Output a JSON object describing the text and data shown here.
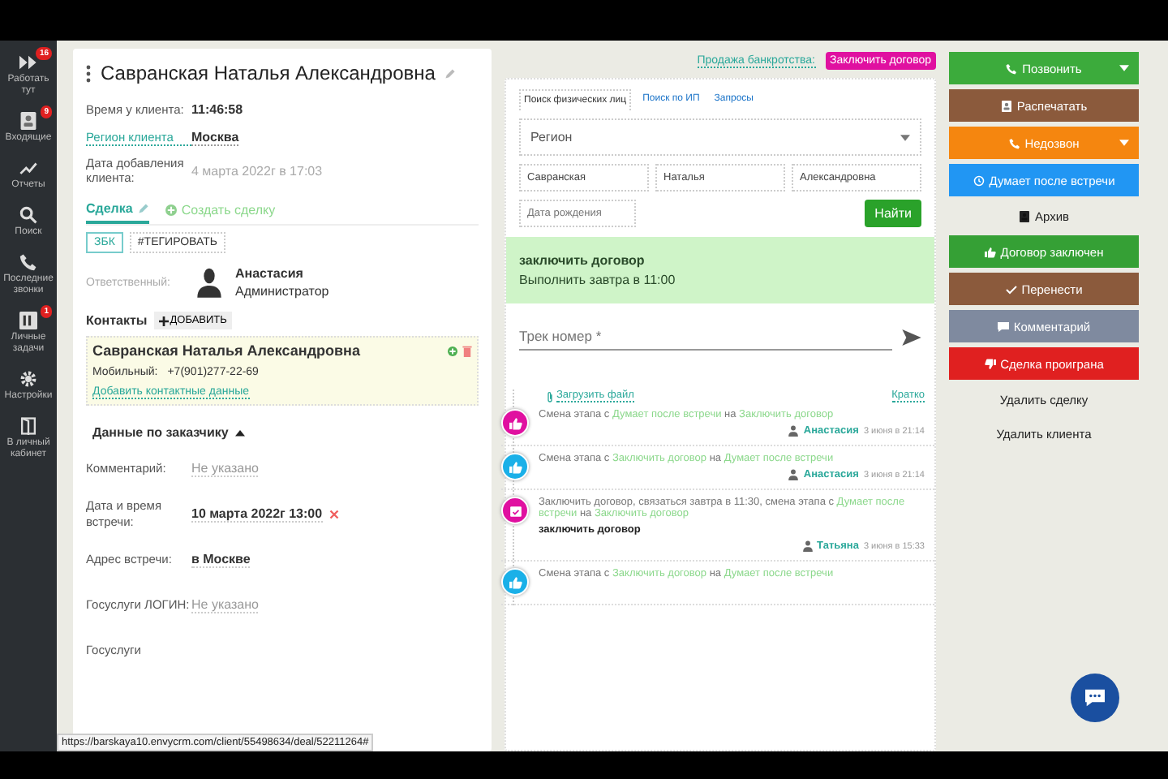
{
  "sidebar": {
    "items": [
      {
        "label": "Работать тут",
        "kind": "forward",
        "badge": "16"
      },
      {
        "label": "Входящие",
        "kind": "contact",
        "badge": "9"
      },
      {
        "label": "Отчеты",
        "kind": "chart"
      },
      {
        "label": "Поиск",
        "kind": "search"
      },
      {
        "label": "Последние звонки",
        "kind": "phone"
      },
      {
        "label": "Личные задачи",
        "kind": "tasks",
        "badge": "1"
      },
      {
        "label": "Настройки",
        "kind": "gear"
      },
      {
        "label": "В личный кабинет",
        "kind": "door"
      }
    ]
  },
  "client": {
    "title": "Савранская Наталья Александровна",
    "fields": [
      {
        "label": "Время у клиента:",
        "value": "11:46:58",
        "kind": "bold"
      },
      {
        "label": "Регион клиента",
        "value": "Москва",
        "kind": "link"
      },
      {
        "label": "Дата добавления клиента:",
        "value": "4 марта 2022г в 17:03",
        "kind": "muted"
      }
    ],
    "tabs": [
      {
        "label": "Сделка",
        "selected": true
      },
      {
        "label": "Создать сделку",
        "selected": false
      }
    ],
    "tags": [
      {
        "label": "ЗБК",
        "kind": "outlined"
      },
      {
        "label": "#ТЕГИРОВАТЬ",
        "kind": "plain"
      }
    ],
    "responsible": {
      "label": "Ответственный:",
      "name": "Анастасия",
      "role": "Администратор"
    },
    "contacts": {
      "title": "Контакты",
      "add": "ДОБАВИТЬ",
      "name": "Савранская Наталья Александровна",
      "phone_label": "Мобильный:",
      "phone": "+7(901)277-22-69",
      "add_link": "Добавить контактные данные"
    },
    "customer": {
      "title": "Данные по заказчику",
      "expanded": true,
      "fields": [
        {
          "label": "Комментарий:",
          "value": "Не указано",
          "kind": "empty"
        },
        {
          "label": "Дата и время встречи:",
          "value": "10 марта 2022г 13:00",
          "kind": "date"
        },
        {
          "label": "Адрес встречи:",
          "value": "в Москве",
          "kind": "set"
        },
        {
          "label": "Госуслуги ЛОГИН:",
          "value": "Не указано",
          "kind": "empty"
        },
        {
          "label": "Госуслуги",
          "kind": "cut"
        }
      ]
    }
  },
  "deal": {
    "pipeline": "Продажа банкротства:",
    "stage": "Заключить договор",
    "search_tabs": [
      {
        "label": "Поиск физических лиц",
        "selected": true
      },
      {
        "label": "Поиск по ИП",
        "selected": false
      },
      {
        "label": "Запросы",
        "selected": false
      }
    ],
    "region": {
      "placeholder": "Регион"
    },
    "inputs": [
      {
        "value": "Савранская"
      },
      {
        "value": "Наталья"
      },
      {
        "value": "Александровна"
      }
    ],
    "birth": {
      "placeholder": "Дата рождения"
    },
    "find": "Найти",
    "task": {
      "title": "заключить договор",
      "due": "Выполнить завтра в 11:00"
    },
    "track": {
      "placeholder": "Трек номер *"
    },
    "upload": "Загрузить файл",
    "brief": "Кратко",
    "timeline": [
      {
        "kind": "thumb",
        "color": "#e010a0",
        "parts": [
          {
            "text": "Смена этапа с ",
            "kind": "plain"
          },
          {
            "text": "Думает после встречи",
            "kind": "link"
          },
          {
            "text": " на ",
            "kind": "plain"
          },
          {
            "text": "Заключить договор",
            "kind": "link"
          }
        ],
        "author": "Анастасия",
        "date": "3 июня в 21:14"
      },
      {
        "kind": "thumb",
        "color": "#1ab0e8",
        "parts": [
          {
            "text": "Смена этапа с ",
            "kind": "plain"
          },
          {
            "text": "Заключить договор",
            "kind": "link"
          },
          {
            "text": " на ",
            "kind": "plain"
          },
          {
            "text": "Думает после встречи",
            "kind": "link"
          }
        ],
        "author": "Анастасия",
        "date": "3 июня в 21:14"
      },
      {
        "kind": "calendar",
        "color": "#e010a0",
        "parts": [
          {
            "text": "Заключить договор, связаться завтра в 11:30, смена этапа с ",
            "kind": "plain"
          },
          {
            "text": "Думает после встречи",
            "kind": "link"
          },
          {
            "text": " на ",
            "kind": "plain"
          },
          {
            "text": "Заключить договор",
            "kind": "link"
          }
        ],
        "note": "заключить договор",
        "author": "Татьяна",
        "date": "3 июня в 15:33"
      },
      {
        "kind": "thumb",
        "color": "#1ab0e8",
        "parts": [
          {
            "text": "Смена этапа с ",
            "kind": "plain"
          },
          {
            "text": "Заключить договор",
            "kind": "link"
          },
          {
            "text": " на ",
            "kind": "plain"
          },
          {
            "text": "Думает после встречи",
            "kind": "link"
          }
        ]
      }
    ]
  },
  "actions": [
    {
      "label": "Позвонить",
      "kind": "phone",
      "color": "#3cab3c",
      "dropdown": true
    },
    {
      "label": "Распечатать",
      "kind": "contact",
      "color": "#8b5a3c",
      "dropdown": false
    },
    {
      "label": "Недозвон",
      "kind": "phone",
      "color": "#f5860f",
      "dropdown": true
    },
    {
      "label": "Думает после встречи",
      "kind": "clock",
      "color": "#2196f3",
      "dropdown": false
    },
    {
      "label": "Архив",
      "kind": "contact",
      "dropdown": false
    },
    {
      "label": "Договор заключен",
      "kind": "thumb",
      "color": "#35a035",
      "dropdown": false
    },
    {
      "label": "Перенести",
      "kind": "check",
      "color": "#8b5a3c",
      "dropdown": false
    },
    {
      "label": "Комментарий",
      "kind": "comment",
      "color": "#7f8a9f",
      "dropdown": false
    },
    {
      "label": "Сделка проиграна",
      "kind": "thumbdown",
      "color": "#e02020",
      "dropdown": false
    },
    {
      "label": "Удалить сделку",
      "dropdown": false
    },
    {
      "label": "Удалить клиента",
      "dropdown": false
    }
  ],
  "status_url": "https://barskaya10.envycrm.com/client/55498634/deal/52211264#"
}
